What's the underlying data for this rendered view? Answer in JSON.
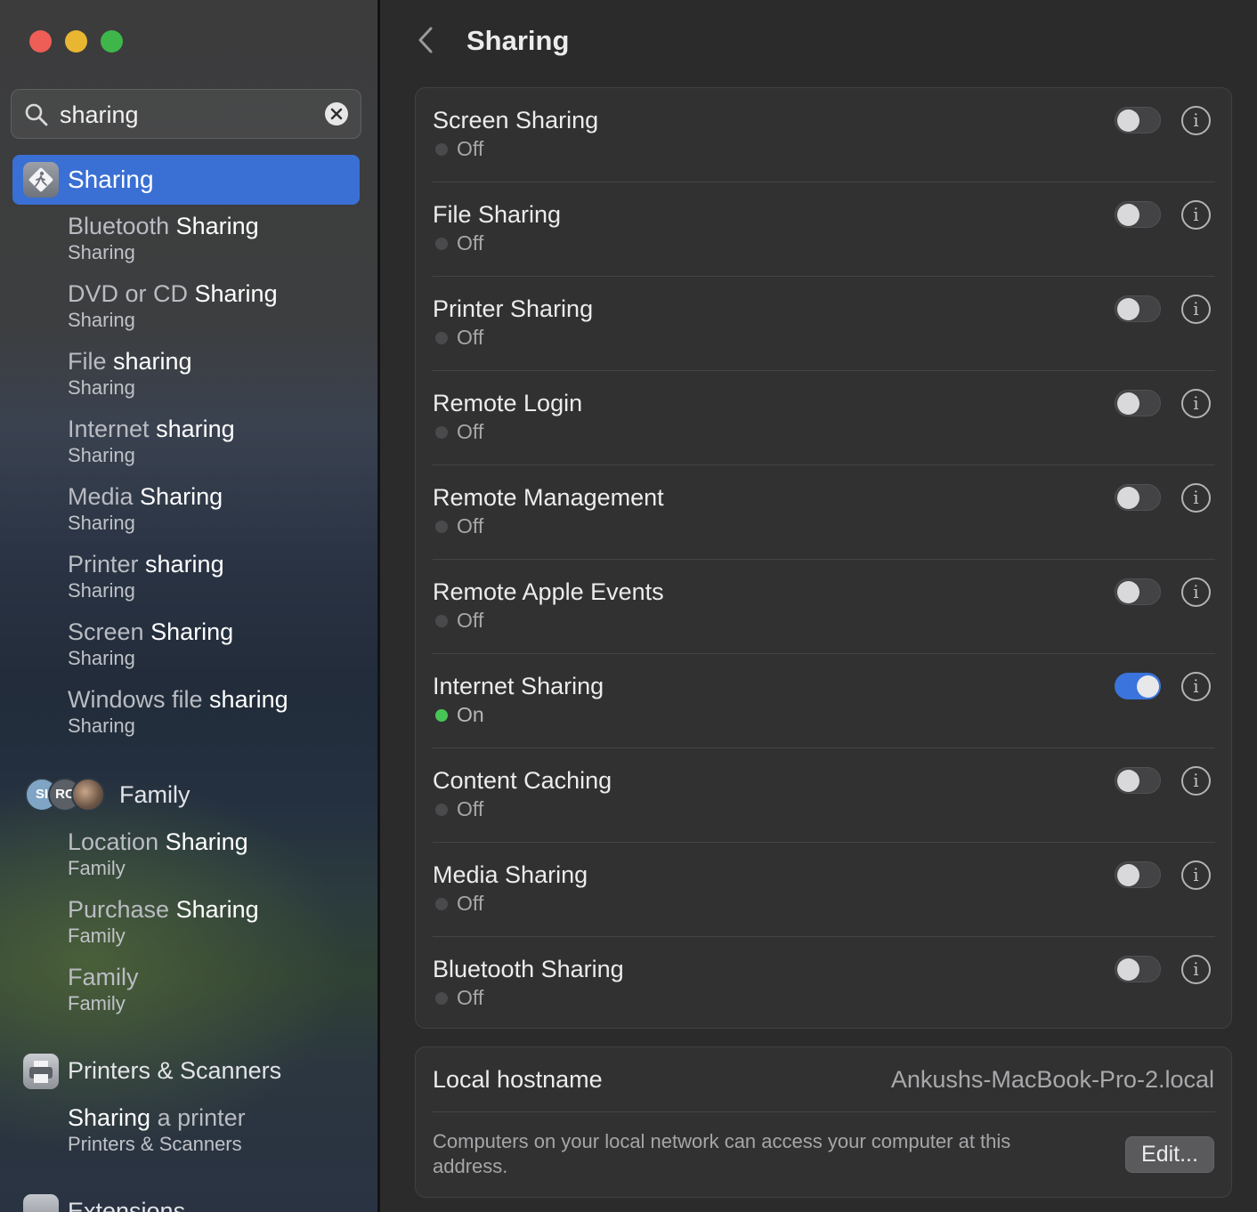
{
  "window": {
    "controls": [
      "close",
      "minimize",
      "zoom"
    ]
  },
  "sidebar": {
    "search": {
      "value": "sharing",
      "icon": "search-icon",
      "clear_icon": "clear-icon"
    },
    "selected": {
      "label": "Sharing",
      "icon": "sharing-icon"
    },
    "sharing_results": [
      {
        "prefix": "Bluetooth ",
        "match": "Sharing",
        "suffix": "",
        "category": "Sharing"
      },
      {
        "prefix": "DVD or CD ",
        "match": "Sharing",
        "suffix": "",
        "category": "Sharing"
      },
      {
        "prefix": "File ",
        "match": "sharing",
        "suffix": "",
        "category": "Sharing"
      },
      {
        "prefix": "Internet ",
        "match": "sharing",
        "suffix": "",
        "category": "Sharing"
      },
      {
        "prefix": "Media ",
        "match": "Sharing",
        "suffix": "",
        "category": "Sharing"
      },
      {
        "prefix": "Printer ",
        "match": "sharing",
        "suffix": "",
        "category": "Sharing"
      },
      {
        "prefix": "Screen ",
        "match": "Sharing",
        "suffix": "",
        "category": "Sharing"
      },
      {
        "prefix": "Windows file ",
        "match": "sharing",
        "suffix": "",
        "category": "Sharing"
      }
    ],
    "family": {
      "label": "Family",
      "avatars": [
        "SI",
        "RC",
        "photo"
      ],
      "results": [
        {
          "prefix": "Location ",
          "match": "Sharing",
          "suffix": "",
          "category": "Family"
        },
        {
          "prefix": "Purchase ",
          "match": "Sharing",
          "suffix": "",
          "category": "Family"
        },
        {
          "prefix": "Family",
          "match": "",
          "suffix": "",
          "category": "Family"
        }
      ]
    },
    "printers": {
      "label": "Printers & Scanners",
      "icon": "printer-icon",
      "results": [
        {
          "prefix": "",
          "match": "Sharing",
          "suffix": " a printer",
          "category": "Printers & Scanners"
        }
      ]
    },
    "extensions": {
      "label": "Extensions"
    }
  },
  "main": {
    "title": "Sharing",
    "back_icon": "chevron-left-icon",
    "services": [
      {
        "name": "Screen Sharing",
        "status": "Off",
        "on": false
      },
      {
        "name": "File Sharing",
        "status": "Off",
        "on": false
      },
      {
        "name": "Printer Sharing",
        "status": "Off",
        "on": false
      },
      {
        "name": "Remote Login",
        "status": "Off",
        "on": false
      },
      {
        "name": "Remote Management",
        "status": "Off",
        "on": false
      },
      {
        "name": "Remote Apple Events",
        "status": "Off",
        "on": false
      },
      {
        "name": "Internet Sharing",
        "status": "On",
        "on": true
      },
      {
        "name": "Content Caching",
        "status": "Off",
        "on": false
      },
      {
        "name": "Media Sharing",
        "status": "Off",
        "on": false
      },
      {
        "name": "Bluetooth Sharing",
        "status": "Off",
        "on": false
      }
    ],
    "hostname": {
      "label": "Local hostname",
      "value": "Ankushs-MacBook-Pro-2.local",
      "description": "Computers on your local network can access your computer at this address.",
      "edit_label": "Edit..."
    }
  },
  "colors": {
    "accent": "#3a6fd4",
    "toggle_on": "#3a74dc",
    "status_on": "#48c557",
    "close": "#ee5e56",
    "minimize": "#e8b631",
    "zoom": "#3fb64a"
  }
}
